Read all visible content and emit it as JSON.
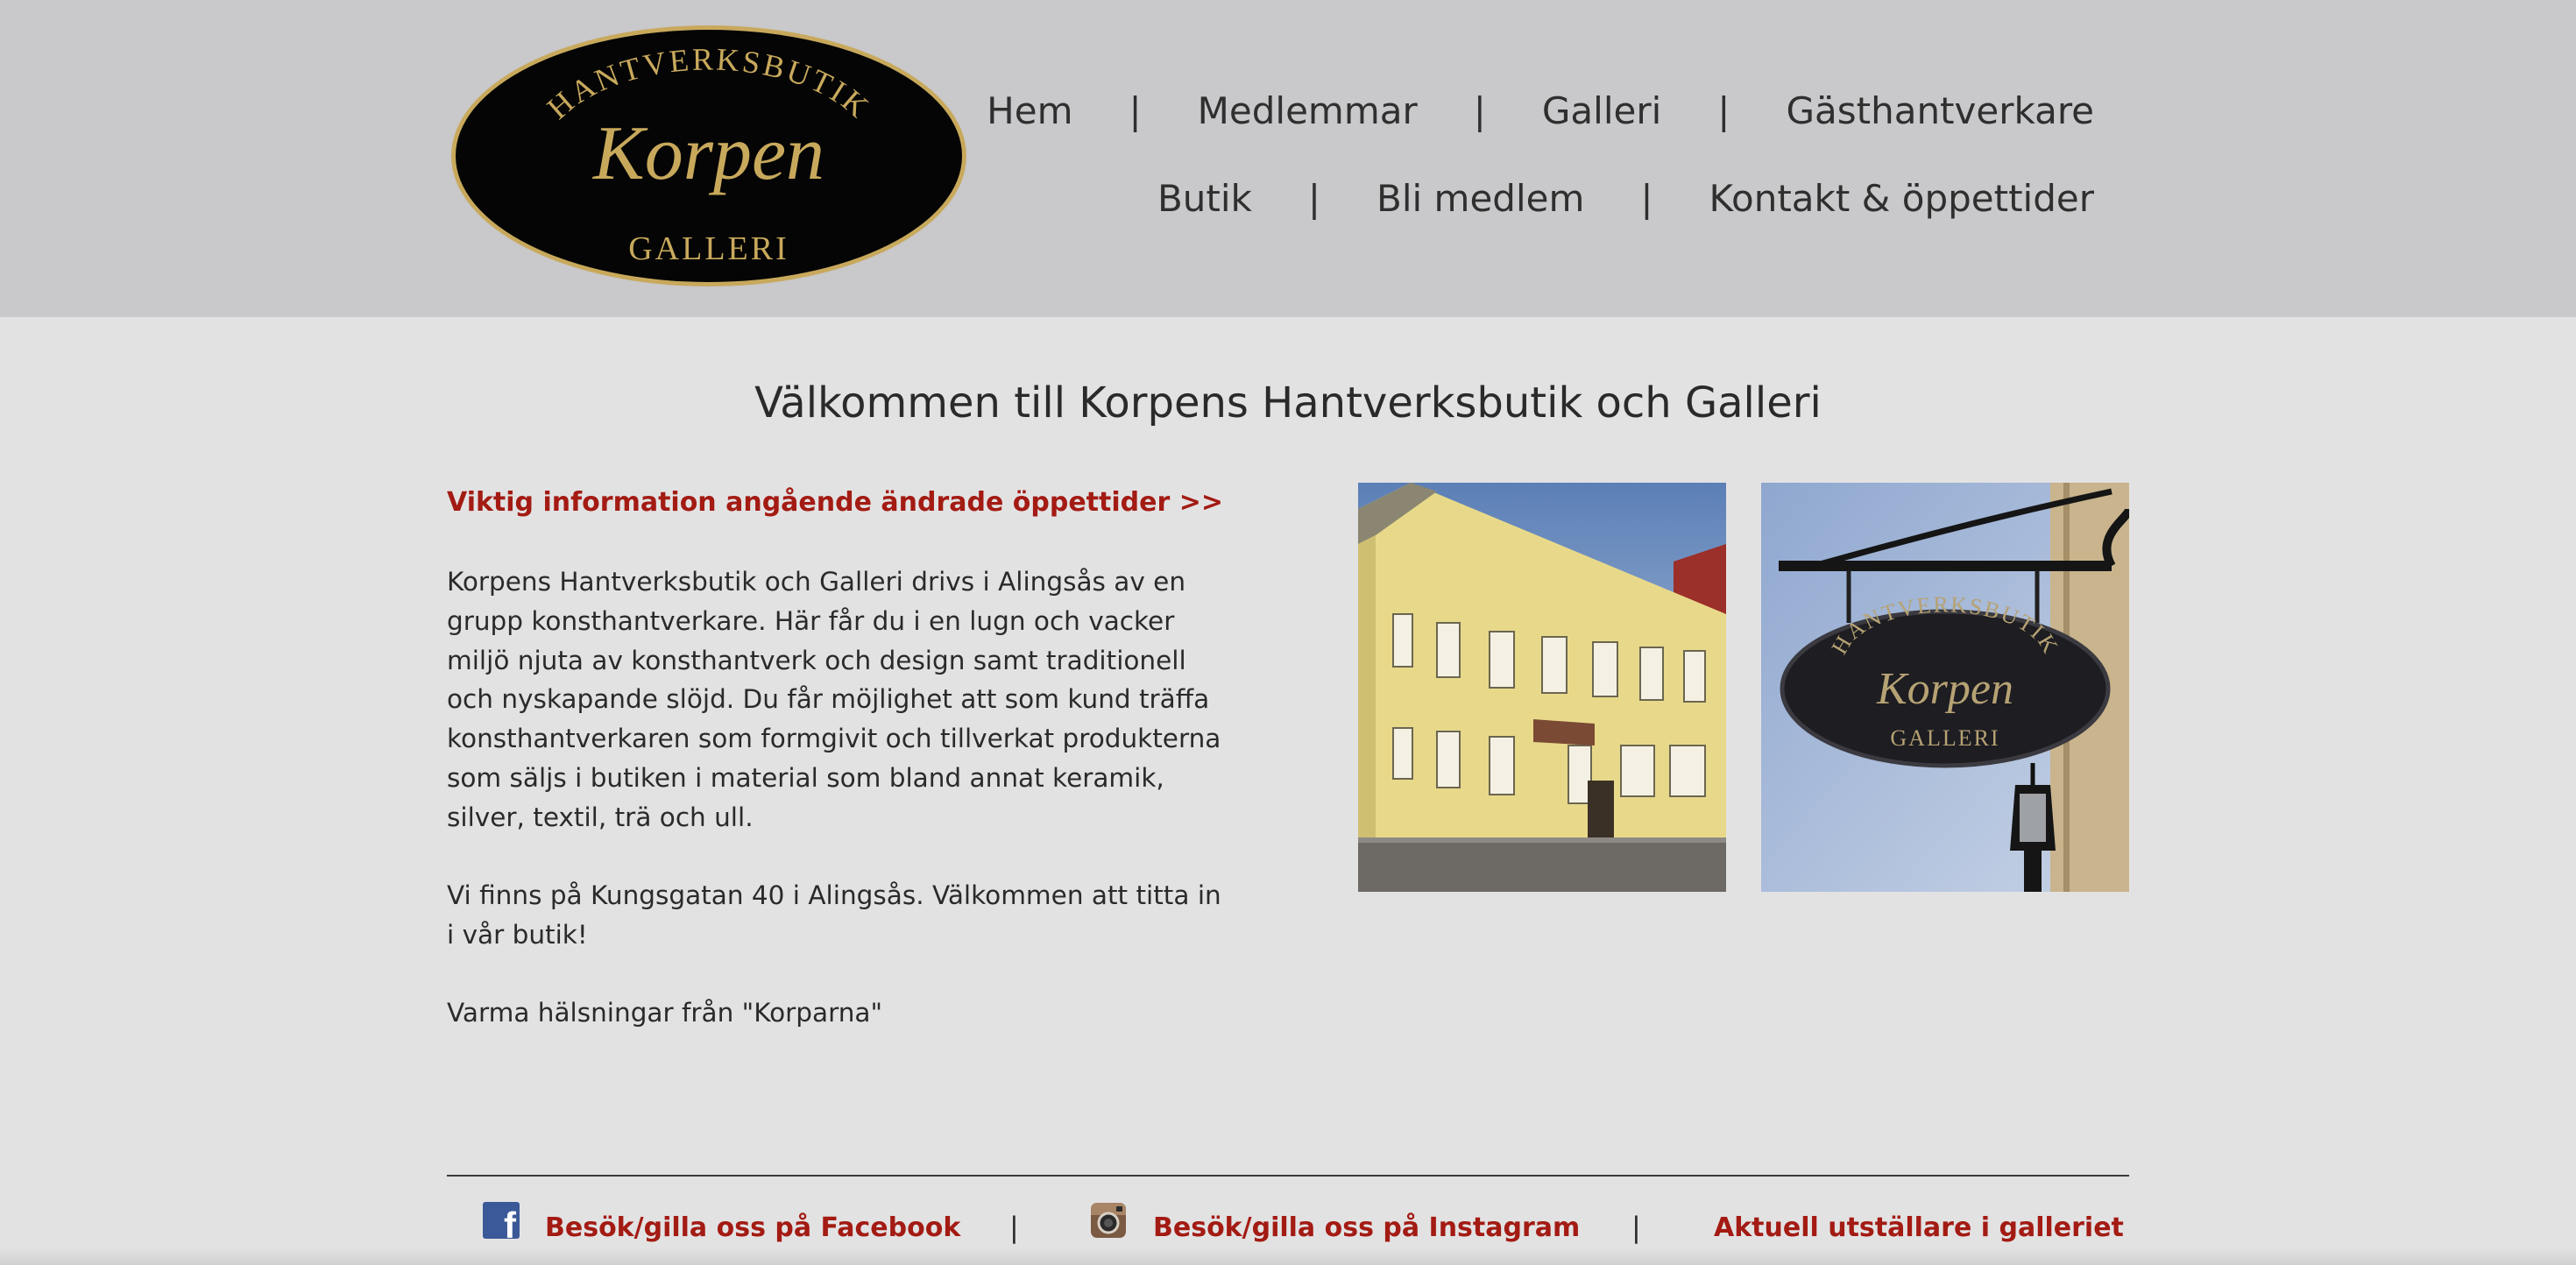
{
  "header": {
    "logo": {
      "top_text": "HANTVERKSBUTIK",
      "name_text": "Korpen",
      "bottom_text": "GALLERI"
    },
    "nav_row1": [
      "Hem",
      "Medlemmar",
      "Galleri",
      "Gästhantverkare"
    ],
    "nav_row2": [
      "Butik",
      "Bli medlem",
      "Kontakt & öppettider"
    ],
    "separator": "|"
  },
  "main": {
    "title": "Välkommen till Korpens Hantverksbutik och Galleri",
    "notice_link": "Viktig information angående ändrade öppettider >>",
    "paragraphs": [
      "Korpens Hantverksbutik och Galleri drivs i Alingsås av en grupp konsthantverkare. Här får du i en lugn och vacker miljö njuta av konsthantverk och design samt traditionell och nyskapande slöjd. Du får möjlighet att som kund träffa konsthantverkaren som formgivit och tillverkat produkterna som säljs i butiken i material som bland annat keramik, silver, textil, trä och ull.",
      "Vi finns på Kungsgatan 40 i Alingsås. Välkommen att titta in i vår butik!",
      "Varma hälsningar från \"Korparna\""
    ],
    "photos": {
      "sign_top_text": "HANTVERKSBUTIK",
      "sign_name_text": "Korpen",
      "sign_bottom_text": "GALLERI"
    }
  },
  "footer": {
    "facebook_link": "Besök/gilla oss på Facebook",
    "instagram_link": "Besök/gilla oss på Instagram",
    "gallery_link": "Aktuell utställare i galleriet",
    "separator": "|",
    "facebook_icon_letter": "f"
  },
  "colors": {
    "header_bg": "#c9c8ca",
    "page_bg": "#e3e2e3",
    "link_red": "#a31b13",
    "logo_gold": "#c8a95c",
    "text": "#2a2a2a"
  },
  "icons": [
    "facebook-icon",
    "instagram-icon"
  ]
}
